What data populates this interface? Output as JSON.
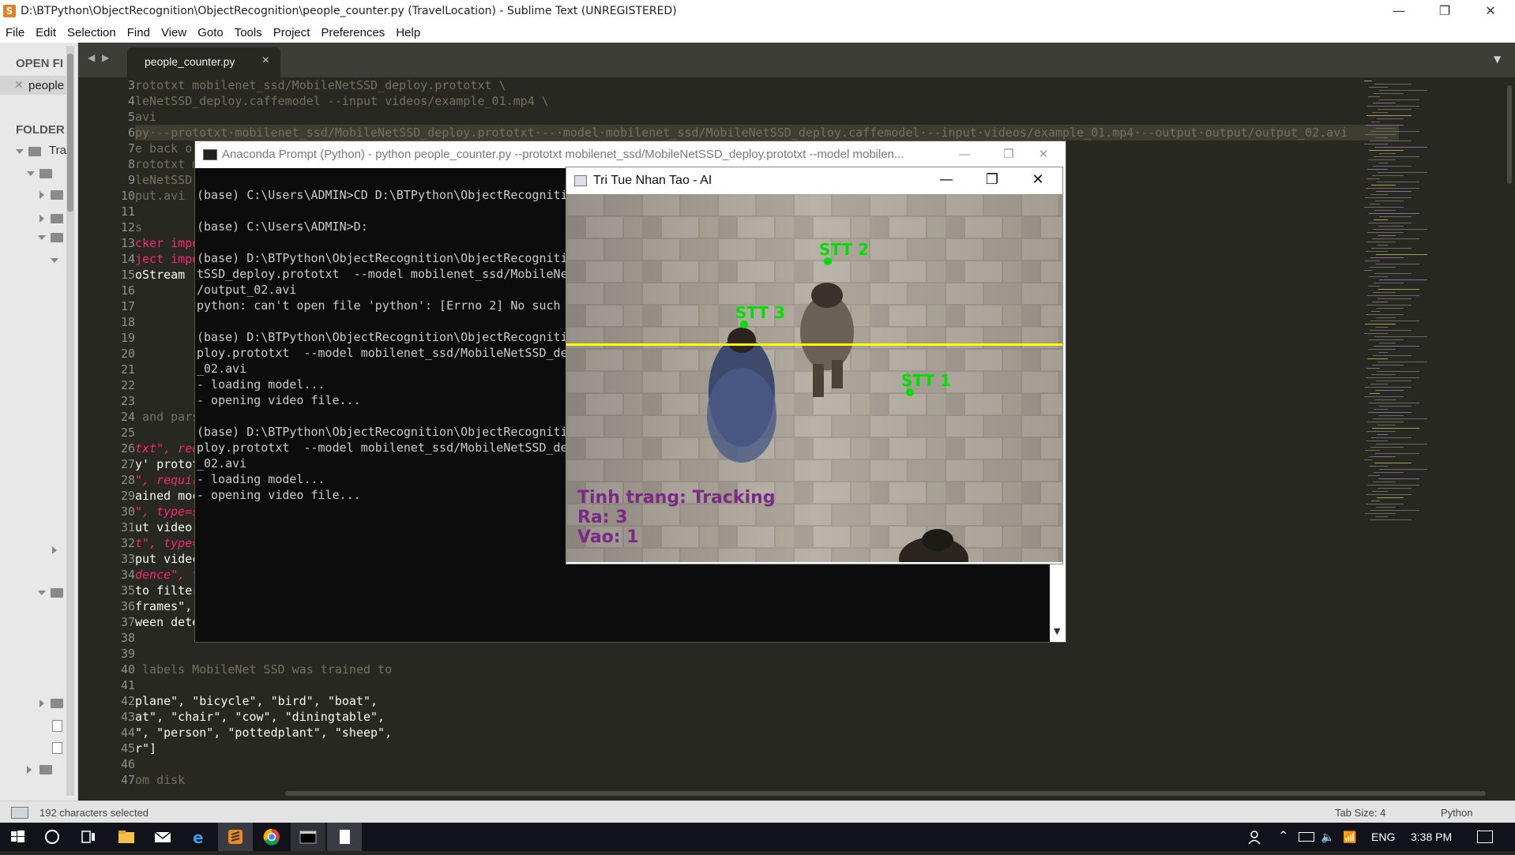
{
  "window": {
    "title": "D:\\BTPython\\ObjectRecognition\\ObjectRecognition\\people_counter.py (TravelLocation) - Sublime Text (UNREGISTERED)",
    "app_icon_letter": "S",
    "minimize": "—",
    "restore": "❐",
    "close": "✕"
  },
  "menu": [
    "File",
    "Edit",
    "Selection",
    "Find",
    "View",
    "Goto",
    "Tools",
    "Project",
    "Preferences",
    "Help"
  ],
  "sidebar": {
    "open_files_label": "OPEN FI",
    "open_file": "people",
    "folders_label": "FOLDER",
    "root_folder": "Tra"
  },
  "tabs": [
    {
      "label": "people_counter.py",
      "close": "×"
    }
  ],
  "tab_nav": {
    "left": "◀",
    "right": "▶",
    "dropdown": "▼"
  },
  "editor": {
    "line_numbers": [
      "3",
      "4",
      "5",
      "6",
      "7",
      "8",
      "9",
      "10",
      "11",
      "12",
      "13",
      "14",
      "15",
      "16",
      "17",
      "18",
      "19",
      "20",
      "21",
      "22",
      "23",
      "24",
      "25",
      "26",
      "27",
      "28",
      "29",
      "30",
      "31",
      "32",
      "33",
      "34",
      "35",
      "36",
      "37",
      "38",
      "39",
      "40",
      "41",
      "42",
      "43",
      "44",
      "45",
      "46",
      "47"
    ],
    "lines": [
      {
        "t": "rototxt mobilenet_ssd/MobileNetSSD_deploy.prototxt \\",
        "c": "com"
      },
      {
        "t": "leNetSSD_deploy.caffemodel --input videos/example_01.mp4 \\",
        "c": "com"
      },
      {
        "t": "avi",
        "c": "com"
      },
      {
        "t": "py·--prototxt·mobilenet_ssd/MobileNetSSD_deploy.prototxt·--·model·mobilenet_ssd/MobileNetSSD_deploy.caffemodel·--input·videos/example_01.mp4·--output·output/output_02.avi",
        "c": "sel"
      },
      {
        "t": "e back o",
        "c": "com"
      },
      {
        "t": "rototxt m",
        "c": "com"
      },
      {
        "t": "leNetSSD",
        "c": "com"
      },
      {
        "t": "put.avi",
        "c": "com"
      },
      {
        "t": "",
        "c": ""
      },
      {
        "t": "s",
        "c": "com"
      },
      {
        "t": "cker impo",
        "c": "kw"
      },
      {
        "t": "ject impo",
        "c": "kw"
      },
      {
        "t": "oStream",
        "c": ""
      },
      {
        "t": "",
        "c": ""
      },
      {
        "t": "",
        "c": ""
      },
      {
        "t": "",
        "c": ""
      },
      {
        "t": "",
        "c": ""
      },
      {
        "t": "",
        "c": ""
      },
      {
        "t": "",
        "c": ""
      },
      {
        "t": "",
        "c": ""
      },
      {
        "t": "",
        "c": ""
      },
      {
        "t": " and pars",
        "c": "com"
      },
      {
        "t": "",
        "c": ""
      },
      {
        "t": "txt\", req",
        "c": "it"
      },
      {
        "t": "y' protot",
        "c": ""
      },
      {
        "t": "\", requir",
        "c": "it"
      },
      {
        "t": "ained moc",
        "c": ""
      },
      {
        "t": "\", type=s",
        "c": "it"
      },
      {
        "t": "ut video",
        "c": ""
      },
      {
        "t": "t\", type=",
        "c": "it"
      },
      {
        "t": "put videc",
        "c": ""
      },
      {
        "t": "dence\", t",
        "c": "it"
      },
      {
        "t": "to filter",
        "c": ""
      },
      {
        "t": "frames\",",
        "c": ""
      },
      {
        "t": "ween dete",
        "c": ""
      },
      {
        "t": "",
        "c": ""
      },
      {
        "t": "",
        "c": ""
      },
      {
        "t": " labels MobileNet SSD was trained to",
        "c": "com"
      },
      {
        "t": "",
        "c": ""
      },
      {
        "t": "plane\", \"bicycle\", \"bird\", \"boat\",",
        "c": ""
      },
      {
        "t": "at\", \"chair\", \"cow\", \"diningtable\",",
        "c": ""
      },
      {
        "t": "\", \"person\", \"pottedplant\", \"sheep\",",
        "c": ""
      },
      {
        "t": "r\"]",
        "c": ""
      },
      {
        "t": "",
        "c": ""
      },
      {
        "t": "om disk",
        "c": "com"
      }
    ]
  },
  "conda": {
    "title": "Anaconda Prompt (Python) - python  people_counter.py --prototxt mobilenet_ssd/MobileNetSSD_deploy.prototxt  --model mobilen...",
    "lines": [
      "",
      "(base) C:\\Users\\ADMIN>CD D:\\BTPython\\ObjectRecogniti",
      "",
      "(base) C:\\Users\\ADMIN>D:",
      "",
      "(base) D:\\BTPython\\ObjectRecognition\\ObjectRecogniti",
      "tSSD_deploy.prototxt  --model mobilenet_ssd/MobileNe",
      "/output_02.avi",
      "python: can't open file 'python': [Errno 2] No such",
      "",
      "(base) D:\\BTPython\\ObjectRecognition\\ObjectRecogniti",
      "ploy.prototxt  --model mobilenet_ssd/MobileNetSSD_de",
      "_02.avi",
      "- loading model...",
      "- opening video file...",
      "",
      "(base) D:\\BTPython\\ObjectRecognition\\ObjectRecogniti",
      "ploy.prototxt  --model mobilenet_ssd/MobileNetSSD_de",
      "_02.avi",
      "- loading model...",
      "- opening video file..."
    ]
  },
  "video": {
    "title": "Tri Tue Nhan Tao - AI",
    "tracks": [
      {
        "label": "STT 2"
      },
      {
        "label": "STT 3"
      },
      {
        "label": "STT 1"
      }
    ],
    "status": "Tinh trang: Tracking",
    "ra": "Ra: 3",
    "vao": "Vao: 1",
    "line_color": "#ffff00",
    "track_color": "#00e000",
    "text_color": "#7a2a82"
  },
  "statusbar": {
    "selection": "192 characters selected",
    "tab_size": "Tab Size: 4",
    "syntax": "Python"
  },
  "taskbar": {
    "language": "ENG",
    "time": "3:38 PM",
    "apps": [
      "start-icon",
      "cortana-icon",
      "task-view-icon",
      "file-explorer-icon",
      "mail-icon",
      "edge-icon",
      "sublime-text-icon",
      "chrome-icon",
      "terminal-icon",
      "notepad-icon"
    ]
  }
}
